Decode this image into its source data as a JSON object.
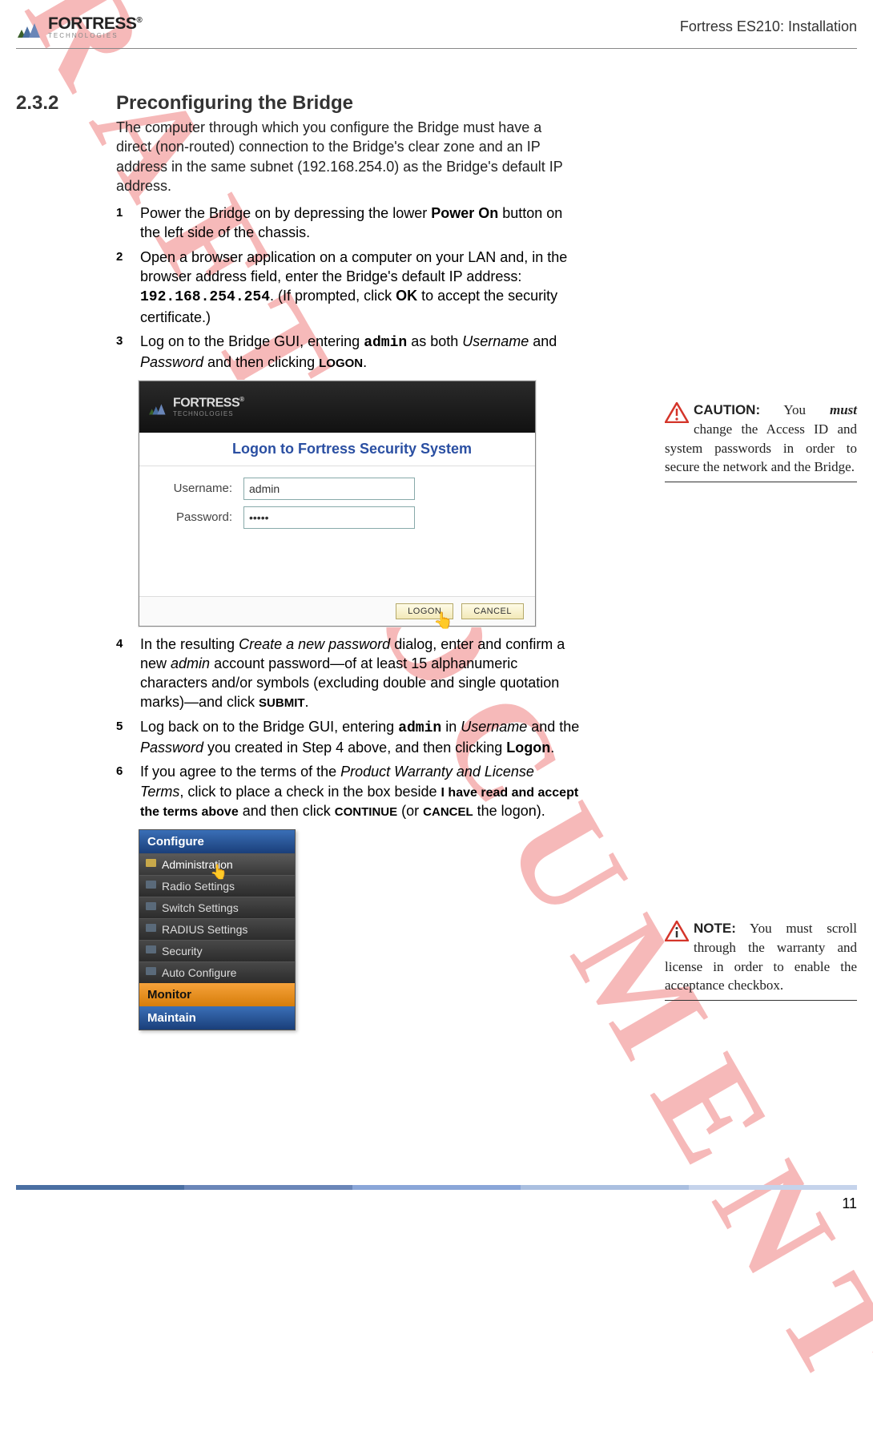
{
  "header": {
    "brand_name": "FORTRESS",
    "brand_sub": "TECHNOLOGIES",
    "registered": "®",
    "doc_title": "Fortress ES210: Installation"
  },
  "watermark": "DRAFT DOCUMENT",
  "section": {
    "number": "2.3.2",
    "title": "Preconfiguring the Bridge"
  },
  "intro": "The computer through which you configure the Bridge must have a direct (non-routed) connection to the Bridge's clear zone and an IP address in the same subnet (192.168.254.0) as the Bridge's default IP address.",
  "steps": {
    "s1": {
      "n": "1",
      "pre": "Power the Bridge on by depressing the lower ",
      "bold1": "Power On",
      "post": " button on the left side of the chassis."
    },
    "s2": {
      "n": "2",
      "pre": "Open a browser application on a computer on your LAN and, in the browser address field, enter the Bridge's default IP address: ",
      "mono": "192.168.254.254",
      "mid": ". (If prompted, click ",
      "bold1": "OK",
      "post": " to accept the security certificate.)"
    },
    "s3": {
      "n": "3",
      "pre": "Log on to the Bridge GUI, entering ",
      "mono": "admin",
      "mid": " as both ",
      "em1": "Username",
      "mid2": " and ",
      "em2": "Password",
      "mid3": " and then clicking ",
      "bold1": "LOGON",
      "post": "."
    },
    "s4": {
      "n": "4",
      "pre": "In the resulting ",
      "em1": "Create a new password",
      "mid": " dialog, enter and confirm a new ",
      "em2": "admin",
      "mid2": " account password—of at least 15 alphanumeric characters and/or symbols (excluding double and single quotation marks)—and click ",
      "bold1": "SUBMIT",
      "post": "."
    },
    "s5": {
      "n": "5",
      "pre": "Log back on to the Bridge GUI, entering ",
      "mono": "admin",
      "mid": " in ",
      "em1": "Username",
      "mid2": " and the ",
      "em2": "Password",
      "mid3": " you created in Step 4 above, and then clicking ",
      "bold1": "Logon",
      "post": "."
    },
    "s6": {
      "n": "6",
      "pre": "If you agree to the terms of the ",
      "em1": "Product Warranty and License Terms",
      "mid": ", click to place a check in the box beside ",
      "bold1": "I have read and accept the terms above",
      "mid2": " and then click ",
      "bold2": "CONTINUE",
      "mid3": " (or ",
      "bold3": "CANCEL",
      "post": " the logon)."
    }
  },
  "logon": {
    "brand": "FORTRESS",
    "brand_sub": "TECHNOLOGIES",
    "title": "Logon to Fortress Security System",
    "username_label": "Username:",
    "username_value": "admin",
    "password_label": "Password:",
    "password_value": "•••••",
    "btn_logon": "LOGON",
    "btn_cancel": "CANCEL"
  },
  "configure_menu": {
    "head": "Configure",
    "items": [
      "Administration",
      "Radio Settings",
      "Switch Settings",
      "RADIUS Settings",
      "Security",
      "Auto Configure"
    ],
    "monitor": "Monitor",
    "maintain": "Maintain"
  },
  "caution": {
    "label": "CAUTION:",
    "lead": " You ",
    "must": "must",
    "rest": " change the Access ID and system passwords in order to secure the network and the Bridge."
  },
  "note": {
    "label": "NOTE:",
    "rest": " You must scroll through the warranty and license in order to enable the acceptance checkbox."
  },
  "page_number": "11"
}
